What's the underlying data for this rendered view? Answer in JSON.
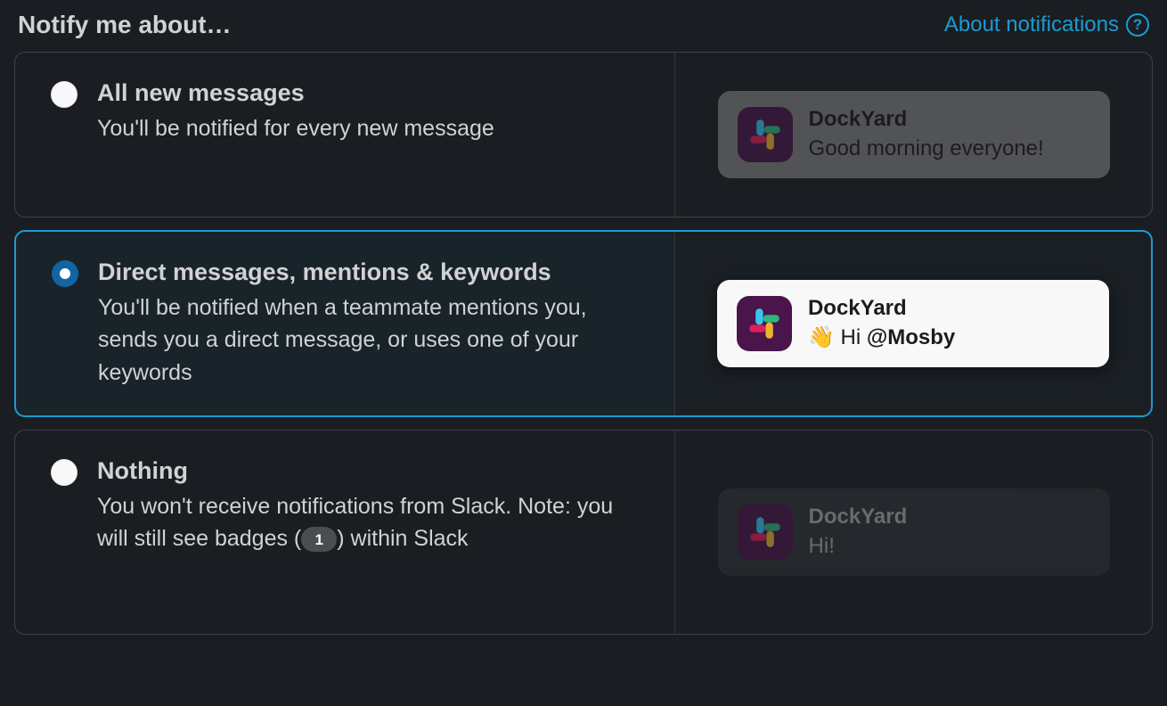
{
  "header": {
    "title": "Notify me about…",
    "about_link": "About notifications"
  },
  "options": [
    {
      "id": "all",
      "title": "All new messages",
      "desc": "You'll be notified for every new message",
      "selected": false,
      "preview": {
        "style": "dim1",
        "sender": "DockYard",
        "message": "Good morning everyone!"
      }
    },
    {
      "id": "dm",
      "title": "Direct messages, mentions & keywords",
      "desc": "You'll be notified when a teammate mentions you, sends you a direct message, or uses one of your keywords",
      "selected": true,
      "preview": {
        "style": "bright",
        "sender": "DockYard",
        "message_prefix": "👋 Hi ",
        "mention": "@Mosby"
      }
    },
    {
      "id": "nothing",
      "title": "Nothing",
      "desc_prefix": "You won't receive notifications from Slack. Note: you will still see badges (",
      "badge": "1",
      "desc_suffix": ") within Slack",
      "selected": false,
      "preview": {
        "style": "dim2",
        "sender": "DockYard",
        "message": "Hi!"
      }
    }
  ]
}
